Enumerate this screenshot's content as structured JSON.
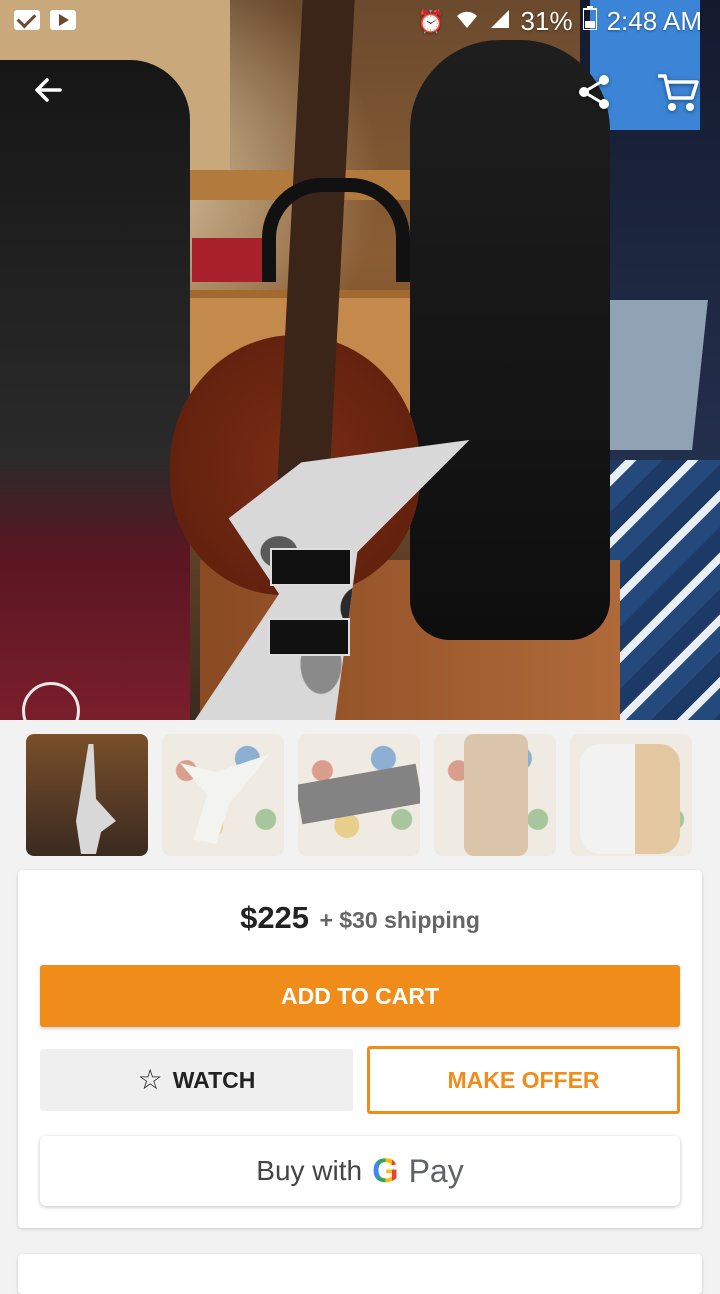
{
  "status_bar": {
    "left_icons": [
      "mail-icon",
      "youtube-icon"
    ],
    "right_icons": [
      "alarm-icon",
      "wifi-icon",
      "signal-icon",
      "battery-icon"
    ],
    "battery": "31%",
    "time": "2:48 AM"
  },
  "app_bar": {
    "back_icon": "back-arrow-icon",
    "share_icon": "share-icon",
    "cart_icon": "cart-icon"
  },
  "gallery": {
    "thumbnail_count": 5,
    "selected_index": 0
  },
  "purchase": {
    "price": "$225",
    "shipping": "+ $30 shipping",
    "add_to_cart_label": "ADD TO CART",
    "watch_label": "WATCH",
    "make_offer_label": "MAKE OFFER",
    "gpay_prefix": "Buy with",
    "gpay_g": "G",
    "gpay_pay": "Pay"
  },
  "colors": {
    "accent": "#f08c19",
    "background": "#f2f2f2"
  }
}
